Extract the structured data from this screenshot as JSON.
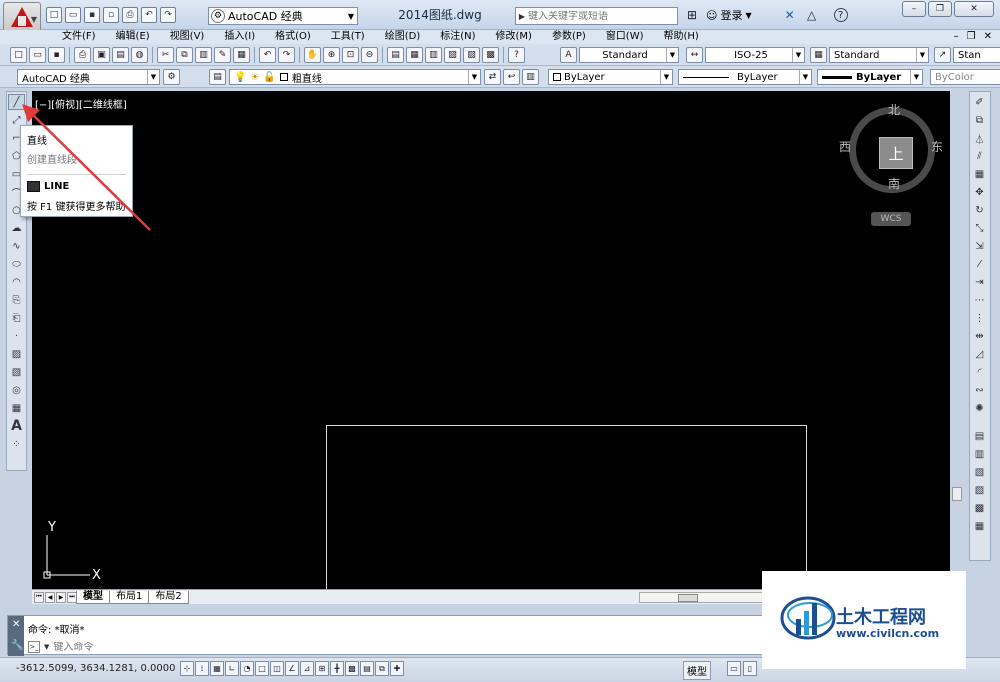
{
  "titlebar": {
    "workspace": "AutoCAD 经典",
    "doc_title": "2014图纸.dwg",
    "search_placeholder": "键入关键字或短语",
    "login": "登录",
    "help": "?"
  },
  "menus": [
    "文件(F)",
    "编辑(E)",
    "视图(V)",
    "插入(I)",
    "格式(O)",
    "工具(T)",
    "绘图(D)",
    "标注(N)",
    "修改(M)",
    "参数(P)",
    "窗口(W)",
    "帮助(H)"
  ],
  "toolbar1": {
    "text_style": "Standard",
    "dim_style": "ISO-25",
    "table_style": "Standard",
    "multileader_style": "Stan"
  },
  "toolbar2": {
    "workspace": "AutoCAD 经典",
    "layer": "粗直线",
    "color": "ByLayer",
    "linetype": "ByLayer",
    "lineweight": "ByLayer",
    "plotstyle": "ByColor"
  },
  "canvas": {
    "viewport_label": "[−][俯视][二维线框]",
    "viewcube": {
      "top": "上",
      "north": "北",
      "south": "南",
      "east": "东",
      "west": "西",
      "wcs": "WCS"
    },
    "ucs_x": "X",
    "ucs_y": "Y"
  },
  "tooltip": {
    "title": "直线",
    "desc": "创建直线段",
    "command": "LINE",
    "help": "按 F1 键获得更多帮助"
  },
  "layout_tabs": [
    "模型",
    "布局1",
    "布局2"
  ],
  "command": {
    "history": "命令:  *取消*",
    "placeholder": "键入命令"
  },
  "status": {
    "coords": "-3612.5099, 3634.1281, 0.0000",
    "model": "模型"
  },
  "watermark": {
    "title": "土木工程网",
    "url": "www.civilcn.com"
  },
  "colors": {
    "canvas": "#000000",
    "accent_arrow": "#e03a3a",
    "brand": "#1c4e91"
  }
}
